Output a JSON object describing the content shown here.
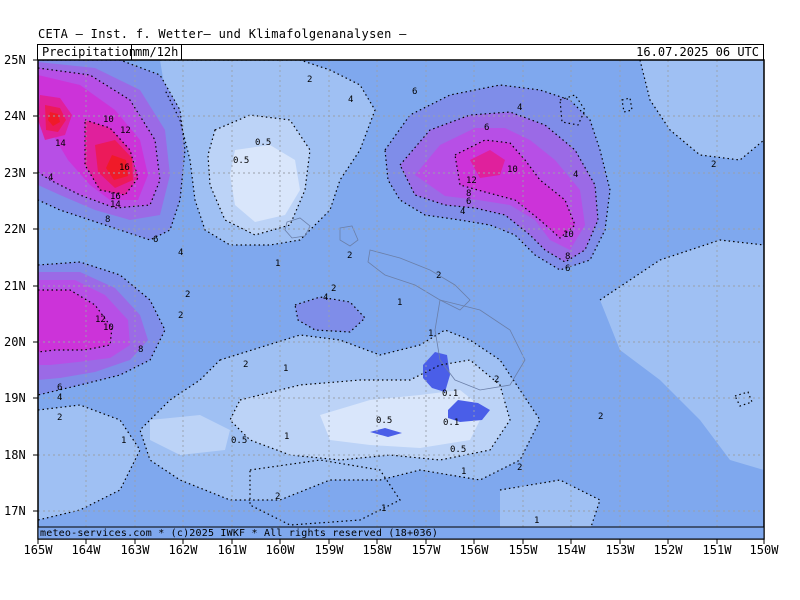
{
  "header": {
    "title": "CETA — Inst. f. Wetter— und Klimafolgenanalysen —",
    "parameter": "Precipitation",
    "unit": "mm/12h",
    "valid_time": "16.07.2025 06 UTC"
  },
  "axes": {
    "lat_labels": [
      "25N",
      "24N",
      "23N",
      "22N",
      "21N",
      "20N",
      "19N",
      "18N",
      "17N"
    ],
    "lon_labels": [
      "165W",
      "164W",
      "163W",
      "162W",
      "161W",
      "160W",
      "159W",
      "158W",
      "157W",
      "156W",
      "155W",
      "154W",
      "153W",
      "152W",
      "151W",
      "150W"
    ]
  },
  "credit": "meteo-services.com * (c)2025 IWKF * All rights reserved (18+036)",
  "contour_labels": [
    "0.1",
    "0.5",
    "1",
    "2",
    "4",
    "6",
    "8",
    "10",
    "12",
    "14",
    "16"
  ],
  "colors": {
    "lt_0_5": "#d9e6fb",
    "c_0_5_1": "#bcd3f7",
    "c_1_2": "#9fc0f3",
    "c_2_4": "#7fa8ee",
    "c_4_6": "#7f8de9",
    "c_6_8": "#9b6ae6",
    "c_8_10": "#b74fe6",
    "c_10_12": "#cc33d9",
    "c_12_14": "#e0209c",
    "c_14_16": "#ec1a5a",
    "c_16_plus": "#f01a28",
    "c_0_1_spot": "#4a5ee8",
    "gridline": "#9aa0aa",
    "contour": "#000000"
  }
}
